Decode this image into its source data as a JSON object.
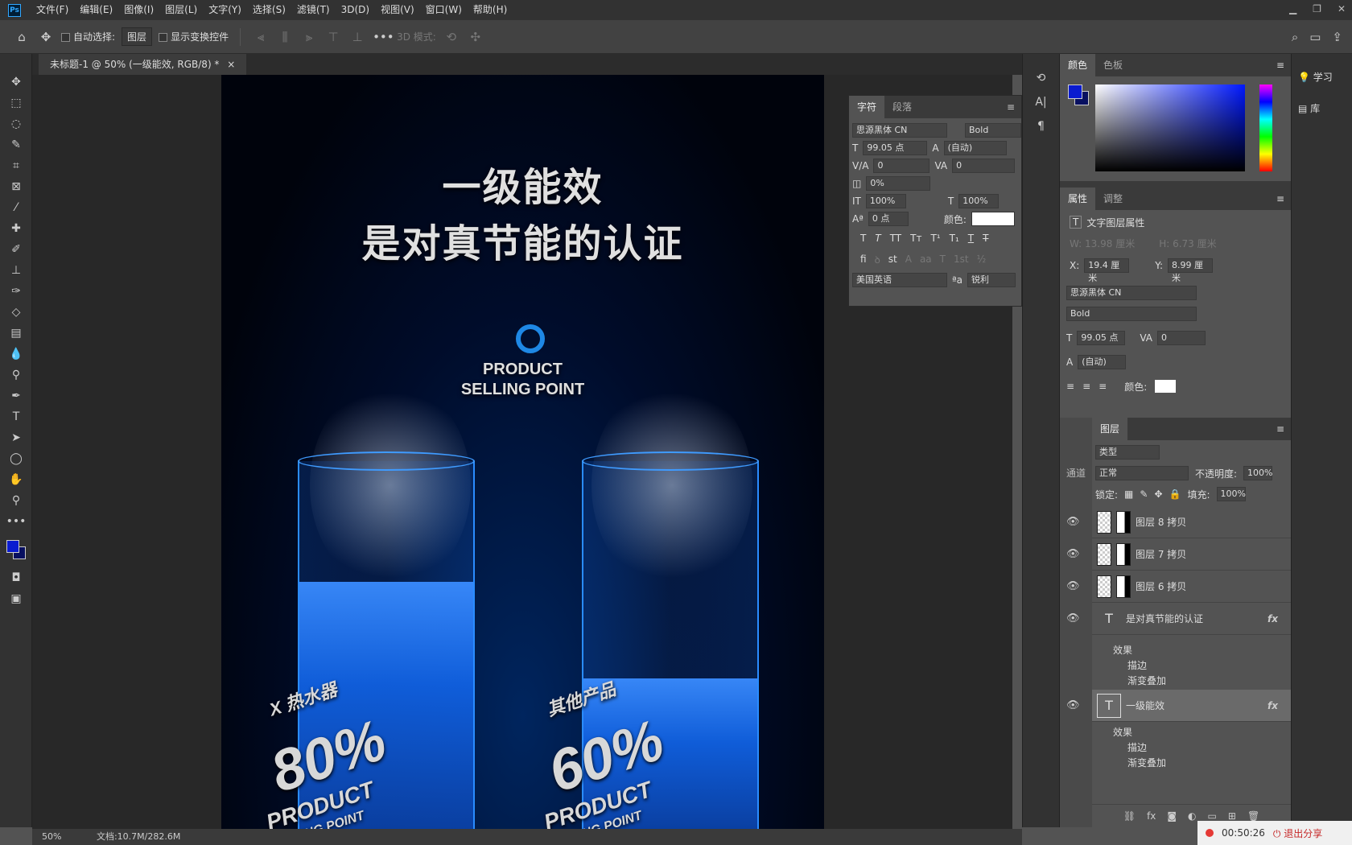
{
  "menus": [
    "文件(F)",
    "编辑(E)",
    "图像(I)",
    "图层(L)",
    "文字(Y)",
    "选择(S)",
    "滤镜(T)",
    "3D(D)",
    "视图(V)",
    "窗口(W)",
    "帮助(H)"
  ],
  "options": {
    "auto_select": "自动选择:",
    "layer_dd": "图层",
    "show_transform": "显示变换控件",
    "mode_3d": "3D 模式:"
  },
  "doc": {
    "tab": "未标题-1 @ 50% (一级能效, RGB/8) *",
    "zoom": "50%",
    "doc_info": "文档:10.7M/282.6M"
  },
  "art": {
    "title1": "一级能效",
    "title2": "是对真节能的认证",
    "logo1": "PRODUCT",
    "logo2": "SELLING POINT",
    "left_label": "X 热水器",
    "left_pct": "80%",
    "left_sub1": "PRODUCT",
    "left_sub2": "SELLING POINT",
    "right_label": "其他产品",
    "right_pct": "60%",
    "right_sub1": "PRODUCT",
    "right_sub2": "SELLING POINT"
  },
  "char_panel": {
    "tab1": "字符",
    "tab2": "段落",
    "font": "思源黑体 CN",
    "style": "Bold",
    "size": "99.05 点",
    "leading": "(自动)",
    "kerning": "0",
    "tracking": "0",
    "tsume": "0%",
    "vscale": "100%",
    "hscale": "100%",
    "baseline": "0 点",
    "color_label": "颜色:",
    "lang": "美国英语",
    "aa_label": "ªa",
    "aa": "锐利"
  },
  "color_panel": {
    "tab1": "颜色",
    "tab2": "色板"
  },
  "props": {
    "tab1": "属性",
    "tab2": "调整",
    "title": "文字图层属性",
    "w": "W: 13.98 厘米",
    "h": "H: 6.73 厘米",
    "x_label": "X:",
    "x": "19.4 厘米",
    "y_label": "Y:",
    "y": "8.99 厘米",
    "font": "思源黑体 CN",
    "style": "Bold",
    "size": "99.05 点",
    "track": "0",
    "leading": "(自动)",
    "color_label": "颜色:"
  },
  "layers": {
    "tab": "图层",
    "filter": "类型",
    "blend": "正常",
    "opacity_label": "不透明度:",
    "opacity": "100%",
    "lock_label": "锁定:",
    "fill_label": "填充:",
    "fill": "100%",
    "channels_tab": "通道",
    "items": [
      "图层 8 拷贝",
      "图层 7 拷贝",
      "图层 6 拷贝",
      "是对真节能的认证",
      "一级能效"
    ],
    "effects": "效果",
    "stroke": "描边",
    "grad": "渐变叠加",
    "fx": "fx"
  },
  "learn": {
    "learn": "学习",
    "lib": "库"
  },
  "record": {
    "time": "00:50:26",
    "exit": "退出分享"
  }
}
